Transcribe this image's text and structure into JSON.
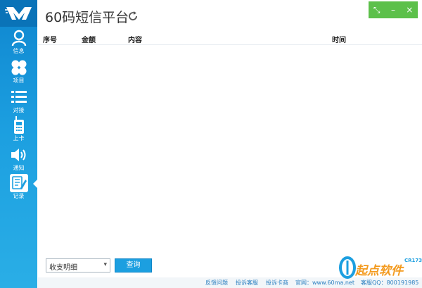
{
  "app": {
    "title": "60码短信平台"
  },
  "sidebar": {
    "items": [
      {
        "label": "信息",
        "icon": "user-icon"
      },
      {
        "label": "项目",
        "icon": "clover-icon"
      },
      {
        "label": "对接",
        "icon": "list-icon"
      },
      {
        "label": "上卡",
        "icon": "phone-icon"
      },
      {
        "label": "通知",
        "icon": "speaker-icon"
      },
      {
        "label": "记录",
        "icon": "record-icon",
        "active": true
      }
    ]
  },
  "window_controls": {
    "restore": "⤡",
    "minimize": "–",
    "close": "×"
  },
  "table": {
    "columns": [
      "序号",
      "金额",
      "内容",
      "时间"
    ],
    "rows": []
  },
  "filter": {
    "selected": "收支明细",
    "arrow": "▾"
  },
  "query_button": {
    "label": "查询"
  },
  "footer": {
    "feedback": "反馈问题",
    "complain_service": "投诉客服",
    "complain_merchant": "投诉卡商",
    "website": "官网：www.60ma.net",
    "qq": "客服QQ：800191985"
  },
  "watermark": {
    "text": "起点软件",
    "sub": "CR173"
  },
  "colors": {
    "sidebar": "#1c9fe0",
    "accent": "#1c9fe0",
    "window_controls": "#5cc04a"
  }
}
